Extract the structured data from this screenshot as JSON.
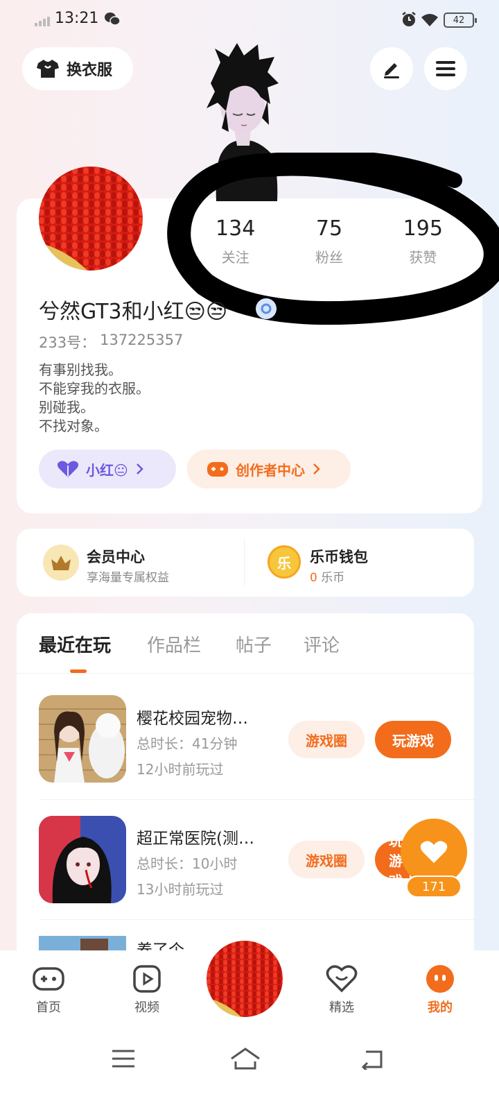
{
  "status_bar": {
    "time": "13:21",
    "battery": "42"
  },
  "header": {
    "outfit_label": "换衣服",
    "icons": [
      "tshirt-icon",
      "edit-icon",
      "menu-icon"
    ]
  },
  "profile": {
    "stats": [
      {
        "value": "134",
        "label": "关注"
      },
      {
        "value": "75",
        "label": "粉丝"
      },
      {
        "value": "195",
        "label": "获赞"
      }
    ],
    "username": "兮然GT3和小红😒😒",
    "id_label": "233号：",
    "id_value": "137225357",
    "bio": [
      "有事别找我。",
      "不能穿我的衣服。",
      "别碰我。",
      "不找对象。"
    ],
    "companion_label": "小红😐",
    "creator_label": "创作者中心"
  },
  "membership": {
    "member_title": "会员中心",
    "member_sub": "享海量专属权益",
    "wallet_title": "乐币钱包",
    "wallet_count": "0",
    "wallet_unit": "乐币",
    "coin_glyph": "乐"
  },
  "tabs": [
    "最近在玩",
    "作品栏",
    "帖子",
    "评论"
  ],
  "games": [
    {
      "title": "樱花校园宠物…",
      "duration": "总时长：41分钟",
      "last_played": "12小时前玩过",
      "circle_label": "游戏圈",
      "play_label": "玩游戏"
    },
    {
      "title": "超正常医院(测…",
      "duration": "总时长：10小时",
      "last_played": "13小时前玩过",
      "circle_label": "游戏圈",
      "play_label": "玩游戏"
    },
    {
      "title": "养了个…"
    }
  ],
  "like_float": {
    "count": "171"
  },
  "bottom_nav": {
    "items": [
      {
        "label": "首页"
      },
      {
        "label": "视频"
      },
      {
        "label": "精选"
      },
      {
        "label": "我的"
      }
    ]
  },
  "colors": {
    "accent": "#f26c1c",
    "companion": "#6b5ae0",
    "like": "#f7931a"
  }
}
